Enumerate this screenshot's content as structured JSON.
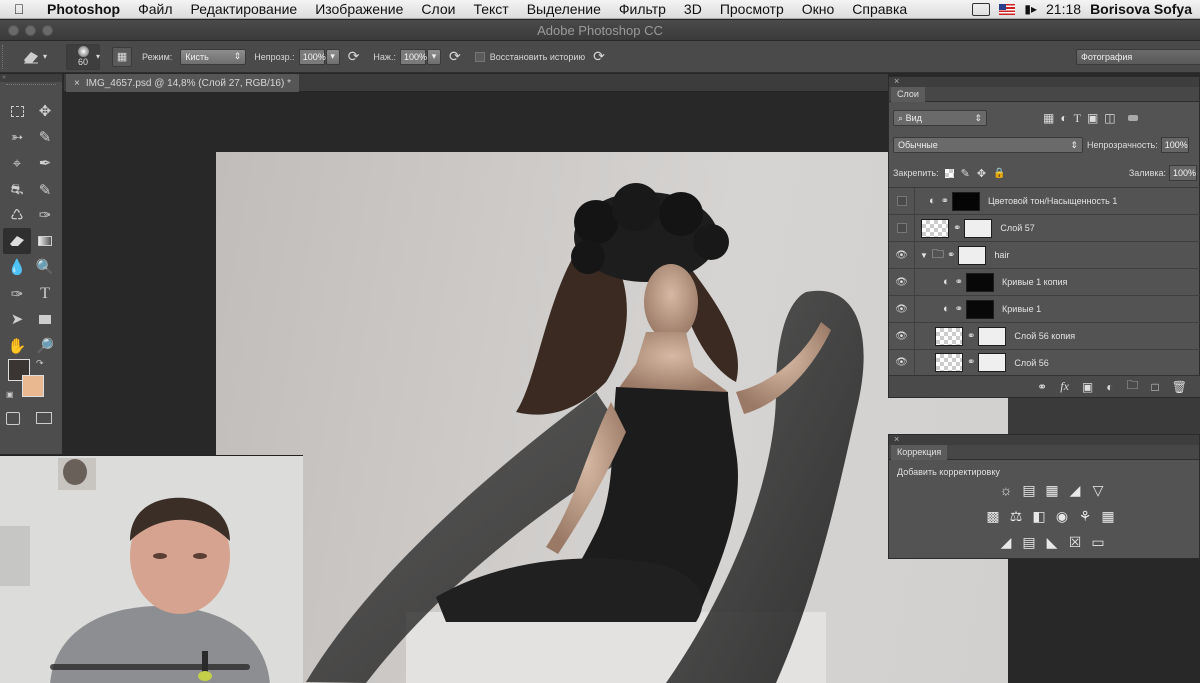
{
  "menubar": {
    "apple": "",
    "app": "Photoshop",
    "items": [
      "Файл",
      "Редактирование",
      "Изображение",
      "Слои",
      "Текст",
      "Выделение",
      "Фильтр",
      "3D",
      "Просмотр",
      "Окно",
      "Справка"
    ],
    "time": "21:18",
    "user": "Borisova Sofya"
  },
  "window": {
    "title": "Adobe Photoshop CC"
  },
  "options": {
    "brush_size": "60",
    "mode_label": "Режим:",
    "mode_value": "Кисть",
    "opacity_label": "Непрозр.:",
    "opacity_value": "100%",
    "flow_label": "Наж.:",
    "flow_value": "100%",
    "history_label": "Восстановить историю",
    "workspace": "Фотография"
  },
  "document": {
    "tab_label": "IMG_4657.psd @ 14,8% (Слой 27, RGB/16) *",
    "close": "×"
  },
  "layers_panel": {
    "close": "×",
    "tab": "Слои",
    "filter": "Вид",
    "blend": "Обычные",
    "opacity_label": "Непрозрачность:",
    "opacity_value": "100%",
    "lock_label": "Закрепить:",
    "fill_label": "Заливка:",
    "fill_value": "100%",
    "layers": [
      {
        "name": "Цветовой тон/Насыщенность 1",
        "visible": false
      },
      {
        "name": "Слой 57",
        "visible": false
      },
      {
        "name": "hair",
        "visible": true
      },
      {
        "name": "Кривые 1 копия",
        "visible": true
      },
      {
        "name": "Кривые 1",
        "visible": true
      },
      {
        "name": "Слой 56 копия",
        "visible": true
      },
      {
        "name": "Слой 56",
        "visible": true
      }
    ]
  },
  "adjustments_panel": {
    "close": "×",
    "tab": "Коррекция",
    "subtitle": "Добавить корректировку"
  },
  "colors": {
    "foreground": "#3a3532",
    "background": "#e9b891",
    "panel": "#535353",
    "selected_layer": "#5f5f5f"
  }
}
